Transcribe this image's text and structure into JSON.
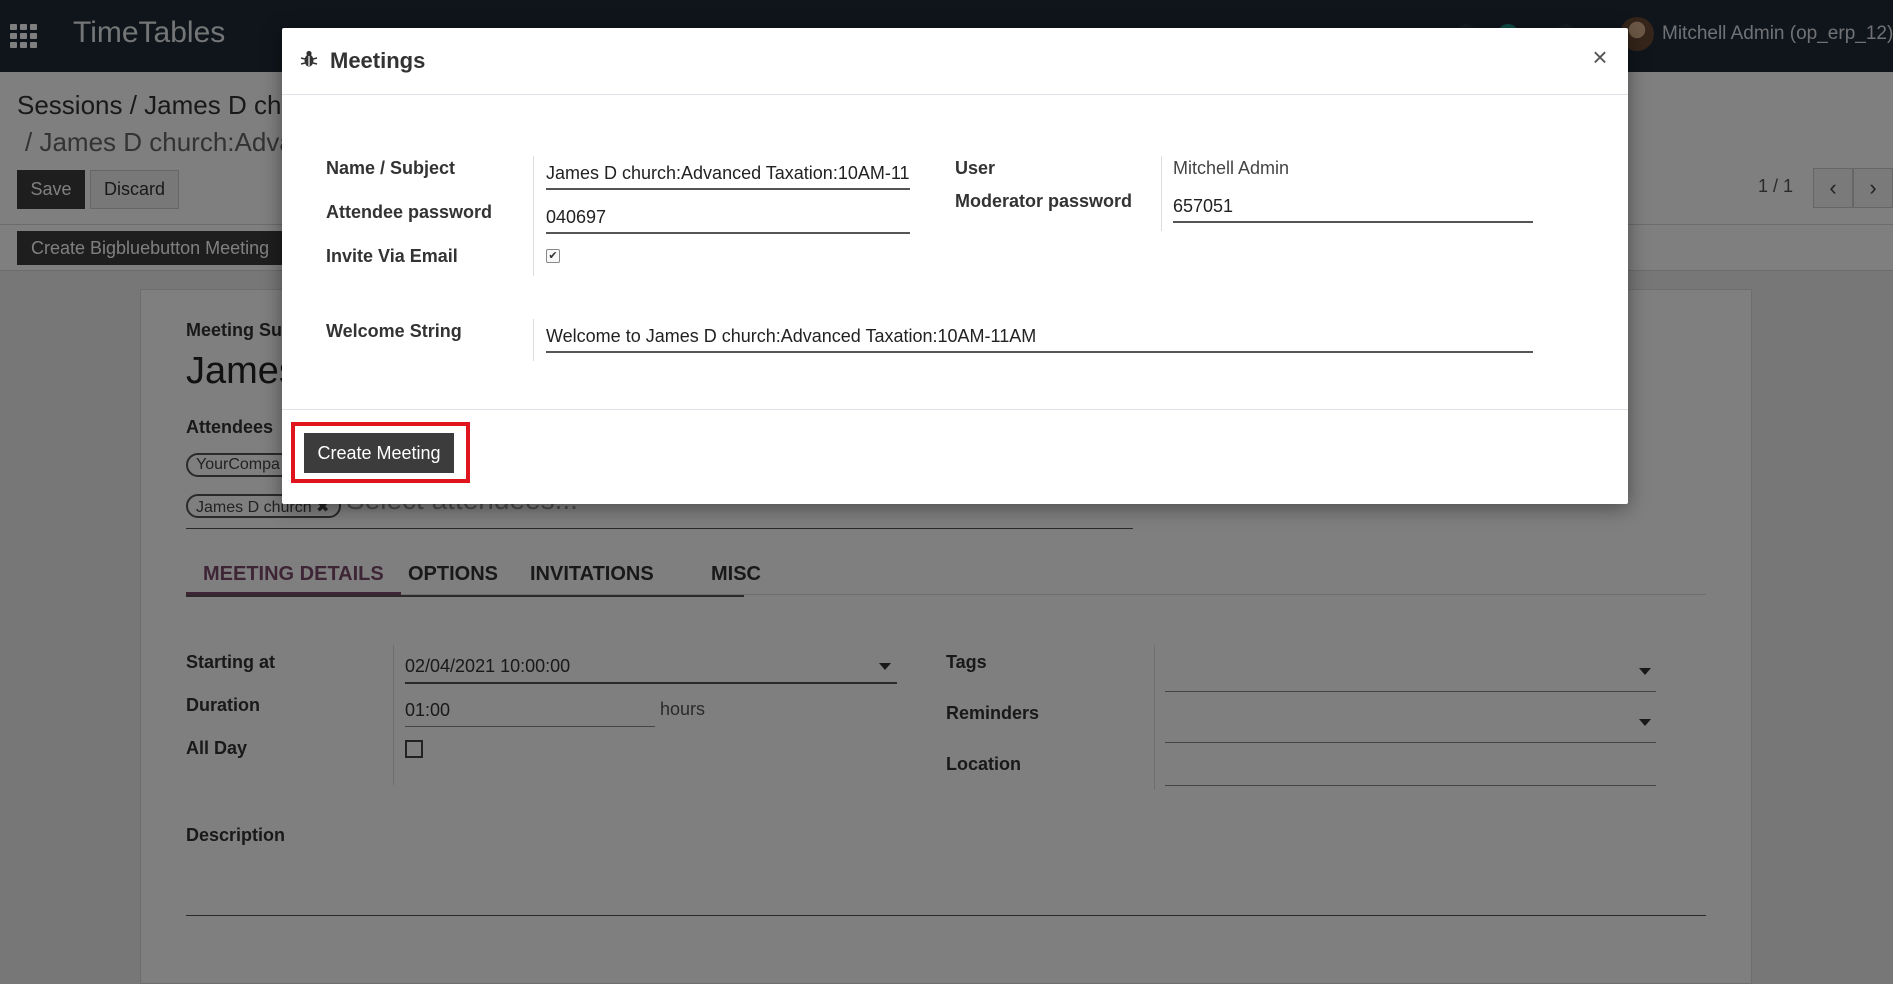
{
  "navbar": {
    "brand": "TimeTables",
    "user": "Mitchell Admin (op_erp_12)"
  },
  "control_panel": {
    "breadcrumb_1": "Sessions / James D chu",
    "breadcrumb_2": "/ James D church:Adva",
    "save_label": "Save",
    "discard_label": "Discard",
    "pager": "1 / 1",
    "bbb_button": "Create Bigbluebutton Meeting"
  },
  "form": {
    "subject_label": "Meeting Su",
    "subject_value": "James",
    "attendees_label": "Attendees",
    "attendee_tags": [
      "YourCompa",
      "James D church ✖"
    ],
    "attendee_placeholder": "Select attendees...",
    "tabs": [
      "MEETING DETAILS",
      "OPTIONS",
      "INVITATIONS",
      "MISC"
    ],
    "starting_at_label": "Starting at",
    "starting_at_value": "02/04/2021 10:00:00",
    "duration_label": "Duration",
    "duration_value": "01:00",
    "duration_unit": "hours",
    "all_day_label": "All Day",
    "tags_label": "Tags",
    "reminders_label": "Reminders",
    "location_label": "Location",
    "description_label": "Description"
  },
  "modal": {
    "title": "Meetings",
    "close": "×",
    "name_label": "Name / Subject",
    "name_value": "James D church:Advanced Taxation:10AM-11",
    "attendee_pw_label": "Attendee password",
    "attendee_pw_value": "040697",
    "invite_label": "Invite Via Email",
    "invite_checked": true,
    "user_label": "User",
    "user_value": "Mitchell Admin",
    "moderator_pw_label": "Moderator password",
    "moderator_pw_value": "657051",
    "welcome_label": "Welcome String",
    "welcome_value": "Welcome to James D church:Advanced Taxation:10AM-11AM",
    "create_button": "Create Meeting"
  },
  "colors": {
    "navbar": "#1f2a36",
    "accent": "#7c4a6d",
    "highlight": "#e0141c",
    "button_dark": "#3c3c3c"
  }
}
